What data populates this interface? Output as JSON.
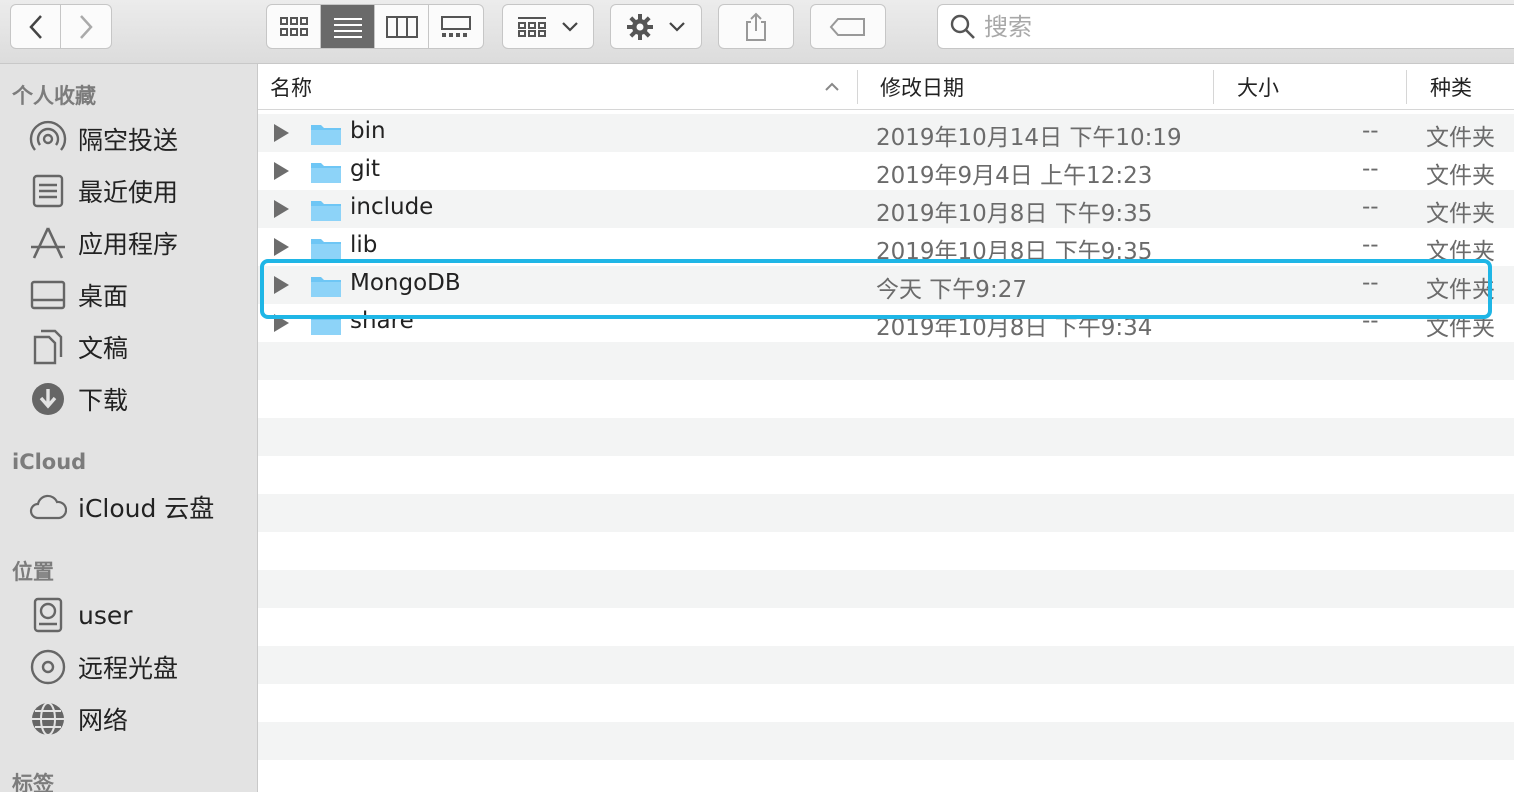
{
  "toolbar": {
    "back_icon": "chevron-left-icon",
    "forward_icon": "chevron-right-icon",
    "view_modes": [
      "icon-view",
      "list-view",
      "column-view",
      "gallery-view"
    ],
    "active_view": "list-view",
    "search_placeholder": "搜索"
  },
  "sidebar": {
    "sections": [
      {
        "title": "个人收藏",
        "items": [
          {
            "label": "隔空投送",
            "icon": "airdrop-icon"
          },
          {
            "label": "最近使用",
            "icon": "recents-icon"
          },
          {
            "label": "应用程序",
            "icon": "applications-icon"
          },
          {
            "label": "桌面",
            "icon": "desktop-icon"
          },
          {
            "label": "文稿",
            "icon": "documents-icon"
          },
          {
            "label": "下载",
            "icon": "downloads-icon"
          }
        ]
      },
      {
        "title": "iCloud",
        "items": [
          {
            "label": "iCloud 云盘",
            "icon": "cloud-icon"
          }
        ]
      },
      {
        "title": "位置",
        "items": [
          {
            "label": "user",
            "icon": "disk-icon"
          },
          {
            "label": "远程光盘",
            "icon": "optical-disc-icon"
          },
          {
            "label": "网络",
            "icon": "network-globe-icon"
          }
        ]
      },
      {
        "title": "标签",
        "items": []
      }
    ]
  },
  "columns": {
    "name": "名称",
    "date": "修改日期",
    "size": "大小",
    "kind": "种类"
  },
  "files": [
    {
      "name": "bin",
      "date": "2019年10月14日 下午10:19",
      "size": "--",
      "kind": "文件夹"
    },
    {
      "name": "git",
      "date": "2019年9月4日 上午12:23",
      "size": "--",
      "kind": "文件夹"
    },
    {
      "name": "include",
      "date": "2019年10月8日 下午9:35",
      "size": "--",
      "kind": "文件夹"
    },
    {
      "name": "lib",
      "date": "2019年10月8日 下午9:35",
      "size": "--",
      "kind": "文件夹"
    },
    {
      "name": "MongoDB",
      "date": "今天 下午9:27",
      "size": "--",
      "kind": "文件夹"
    },
    {
      "name": "share",
      "date": "2019年10月8日 下午9:34",
      "size": "--",
      "kind": "文件夹"
    }
  ],
  "colors": {
    "highlight": "#1fb6e6",
    "folder": "#6ec6f5"
  }
}
